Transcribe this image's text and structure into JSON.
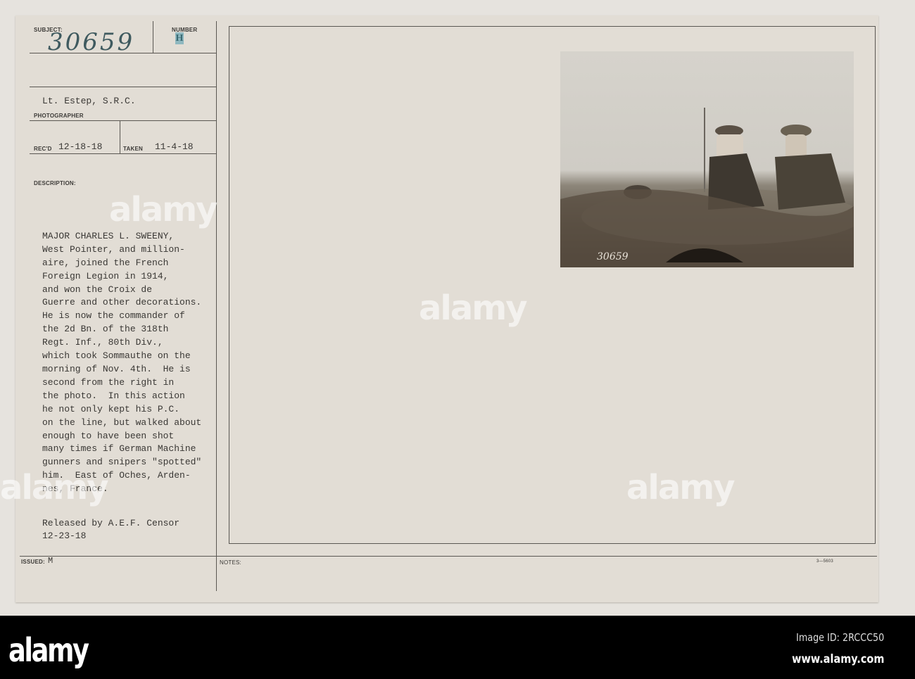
{
  "card": {
    "subject_label": "SUBJECT:",
    "subject_number": "30659",
    "number_label": "NUMBER",
    "number_stamp": "H",
    "photographer": "Lt. Estep, S.R.C.",
    "photographer_label": "PHOTOGRAPHER",
    "recd_label": "REC'D",
    "recd_date": "12-18-18",
    "taken_label": "TAKEN",
    "taken_date": "11-4-18",
    "description_label": "DESCRIPTION:",
    "description_lines": [
      "MAJOR CHARLES L. SWEENY,",
      "West Pointer, and million-",
      "aire, joined the French",
      "Foreign Legion in 1914,",
      "and won the Croix de",
      "Guerre and other decorations.",
      "He is now the commander of",
      "the 2d Bn. of the 318th",
      "Regt. Inf., 80th Div.,",
      "which took Sommauthe on the",
      "morning of Nov. 4th.  He is",
      "second from the right in",
      "the photo.  In this action",
      "he not only kept his P.C.",
      "on the line, but walked about",
      "enough to have been shot",
      "many times if German Machine",
      "gunners and snipers \"spotted\"",
      "him.  East of Oches, Arden-",
      "nes, France."
    ],
    "release_line": "Released by A.E.F. Censor",
    "release_date": "12-23-18",
    "issued_label": "ISSUED:",
    "issued_value": "M",
    "notes_label": "NOTES:",
    "form_code": "3—5603",
    "photo_caption_number": "30659"
  },
  "watermark": "alamy",
  "footer": {
    "logo": "alamy",
    "image_id": "Image ID: 2RCCC50",
    "site": "www.alamy.com"
  }
}
